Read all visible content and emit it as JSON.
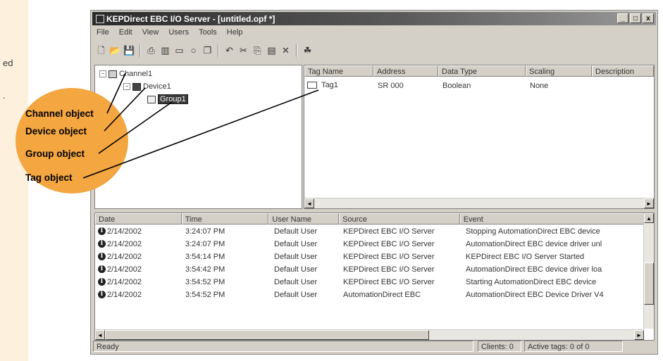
{
  "side_text": [
    "ed",
    "."
  ],
  "window": {
    "title": "KEPDirect EBC I/O Server - [untitled.opf *]",
    "controls": [
      "_",
      "□",
      "x"
    ]
  },
  "menu": [
    "File",
    "Edit",
    "View",
    "Users",
    "Tools",
    "Help"
  ],
  "toolbar_icons": [
    "new-icon",
    "open-icon",
    "save-icon",
    "sep",
    "new-channel-icon",
    "new-device-icon",
    "new-group-icon",
    "new-tag-icon",
    "properties-icon",
    "sep",
    "undo-icon",
    "cut-icon",
    "copy-icon",
    "paste-icon",
    "delete-icon",
    "sep",
    "quick-client-icon"
  ],
  "tree": {
    "channel": "Channel1",
    "device": "Device1",
    "group": "Group1"
  },
  "tag_table": {
    "headers": [
      "Tag Name",
      "Address",
      "Data Type",
      "Scaling",
      "Description"
    ],
    "rows": [
      [
        "Tag1",
        "SR 000",
        "Boolean",
        "None",
        ""
      ]
    ]
  },
  "event_log": {
    "headers": [
      "Date",
      "Time",
      "User Name",
      "Source",
      "Event"
    ],
    "rows": [
      [
        "2/14/2002",
        "3:24:07 PM",
        "Default User",
        "KEPDirect EBC I/O Server",
        "Stopping AutomationDirect EBC device"
      ],
      [
        "2/14/2002",
        "3:24:07 PM",
        "Default User",
        "KEPDirect EBC I/O Server",
        "AutomationDirect EBC device driver unl"
      ],
      [
        "2/14/2002",
        "3:54:14 PM",
        "Default User",
        "KEPDirect EBC I/O Server",
        "KEPDirect EBC I/O Server Started"
      ],
      [
        "2/14/2002",
        "3:54:42 PM",
        "Default User",
        "KEPDirect EBC I/O Server",
        "AutomationDirect EBC device driver loa"
      ],
      [
        "2/14/2002",
        "3:54:52 PM",
        "Default User",
        "KEPDirect EBC I/O Server",
        "Starting AutomationDirect EBC device"
      ],
      [
        "2/14/2002",
        "3:54:52 PM",
        "Default User",
        "AutomationDirect EBC",
        "AutomationDirect EBC Device Driver V4"
      ]
    ]
  },
  "status": {
    "left": "Ready",
    "clients": "Clients: 0",
    "active_tags": "Active tags: 0 of 0"
  },
  "callouts": {
    "channel": "Channel object",
    "device": "Device object",
    "group": "Group object",
    "tag": "Tag object"
  },
  "colors": {
    "callout_bubble": "#f4a640",
    "side_strip": "#fdf1de",
    "window_face": "#d4d0c8"
  }
}
